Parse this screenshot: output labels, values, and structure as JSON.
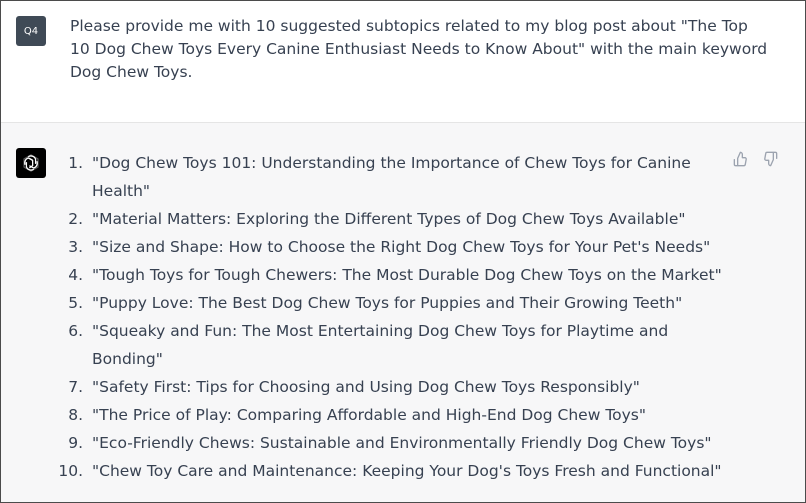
{
  "user_message": {
    "avatar_label": "Q4",
    "text": "Please provide me with 10 suggested subtopics related to my blog post about \"The Top 10 Dog Chew Toys Every Canine Enthusiast Needs to Know About\" with the main keyword Dog Chew Toys."
  },
  "assistant_message": {
    "avatar_icon": "openai-logo-icon",
    "items": [
      {
        "num": "1.",
        "text": "\"Dog Chew Toys 101: Understanding the Importance of Chew Toys for Canine Health\""
      },
      {
        "num": "2.",
        "text": "\"Material Matters: Exploring the Different Types of Dog Chew Toys Available\""
      },
      {
        "num": "3.",
        "text": "\"Size and Shape: How to Choose the Right Dog Chew Toys for Your Pet's Needs\""
      },
      {
        "num": "4.",
        "text": "\"Tough Toys for Tough Chewers: The Most Durable Dog Chew Toys on the Market\""
      },
      {
        "num": "5.",
        "text": "\"Puppy Love: The Best Dog Chew Toys for Puppies and Their Growing Teeth\""
      },
      {
        "num": "6.",
        "text": "\"Squeaky and Fun: The Most Entertaining Dog Chew Toys for Playtime and Bonding\""
      },
      {
        "num": "7.",
        "text": "\"Safety First: Tips for Choosing and Using Dog Chew Toys Responsibly\""
      },
      {
        "num": "8.",
        "text": "\"The Price of Play: Comparing Affordable and High-End Dog Chew Toys\""
      },
      {
        "num": "9.",
        "text": "\"Eco-Friendly Chews: Sustainable and Environmentally Friendly Dog Chew Toys\""
      },
      {
        "num": "10.",
        "text": "\"Chew Toy Care and Maintenance: Keeping Your Dog's Toys Fresh and Functional\""
      }
    ],
    "feedback_icons": [
      "thumbs-up-icon",
      "thumbs-down-icon"
    ]
  },
  "colors": {
    "user_bg": "#ffffff",
    "assistant_bg": "#f7f7f8",
    "user_avatar_bg": "#3f4a56",
    "assistant_avatar_bg": "#000000",
    "text": "#374151",
    "icon": "#9ca3af"
  }
}
